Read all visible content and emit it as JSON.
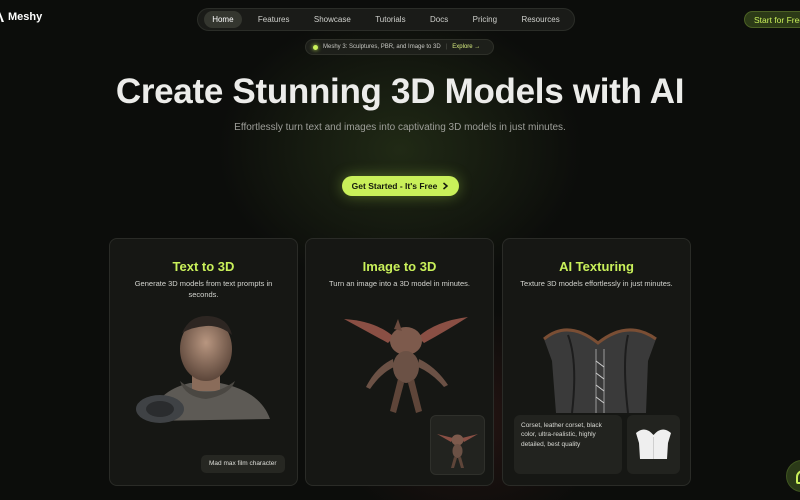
{
  "brand": {
    "name": "Meshy"
  },
  "nav": {
    "items": [
      {
        "label": "Home",
        "active": true
      },
      {
        "label": "Features",
        "active": false
      },
      {
        "label": "Showcase",
        "active": false
      },
      {
        "label": "Tutorials",
        "active": false
      },
      {
        "label": "Docs",
        "active": false
      },
      {
        "label": "Pricing",
        "active": false
      },
      {
        "label": "Resources",
        "active": false
      }
    ],
    "start_label": "Start for Free"
  },
  "announcement": {
    "text": "Meshy 3: Sculptures, PBR, and Image to 3D",
    "separator": "|",
    "link": "Explore →"
  },
  "hero": {
    "title": "Create Stunning 3D Models with AI",
    "subtitle": "Effortlessly turn text and images into captivating 3D models in just minutes.",
    "cta": "Get Started - It's Free",
    "cta_icon": "chevron-right-icon"
  },
  "cards": [
    {
      "title": "Text to 3D",
      "description": "Generate 3D models from text prompts in seconds.",
      "caption": "Mad max film character"
    },
    {
      "title": "Image to 3D",
      "description": "Turn an image into a 3D model in minutes."
    },
    {
      "title": "AI Texturing",
      "description": "Texture 3D models effortlessly in just minutes.",
      "prompt": "Corset, leather corset, black color, ultra-realistic, highly detailed, best quality"
    }
  ],
  "colors": {
    "accent": "#c9f05a",
    "background": "#0c0d0b",
    "card": "#161714"
  }
}
